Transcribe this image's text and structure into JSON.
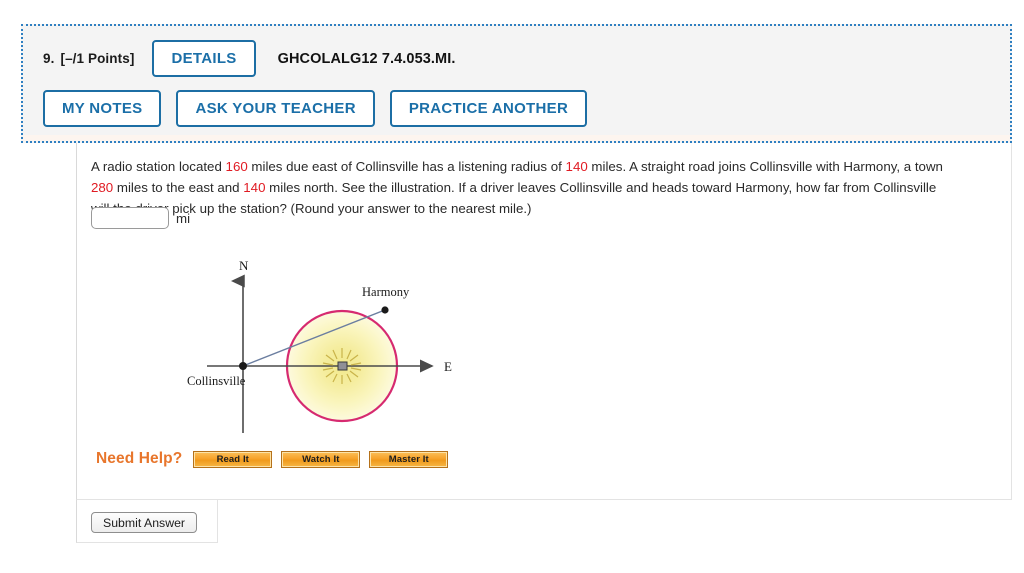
{
  "header": {
    "question_number": "9.",
    "points": "[–/1 Points]",
    "details_label": "DETAILS",
    "question_code": "GHCOLALG12 7.4.053.MI.",
    "my_notes_label": "MY NOTES",
    "ask_teacher_label": "ASK YOUR TEACHER",
    "practice_another_label": "PRACTICE ANOTHER"
  },
  "question": {
    "text_part_1": "A radio station located ",
    "value_1": "160",
    "text_part_2": " miles due east of Collinsville has a listening radius of ",
    "value_2": "140",
    "text_part_3": " miles. A straight road joins Collinsville with Harmony, a town ",
    "value_3": "280",
    "text_part_4": " miles to the east and ",
    "value_4": "140",
    "text_part_5": " miles north. See the illustration. If a driver leaves Collinsville and heads toward Harmony, how far from Collinsville will the driver pick up the station? (Round your answer to the nearest mile.)",
    "answer_value": "",
    "answer_placeholder": "",
    "unit": "mi"
  },
  "illustration": {
    "north_label": "N",
    "east_label": "E",
    "origin_label": "Collinsville",
    "town_label": "Harmony",
    "circle_color": "#d62a70",
    "fill_color": "#f7ef9c",
    "road_color": "#5a6e93",
    "axis_color": "#4a4a4a"
  },
  "need_help": {
    "label": "Need Help?",
    "buttons": [
      {
        "label": "Read It"
      },
      {
        "label": "Watch It"
      },
      {
        "label": "Master It"
      }
    ]
  },
  "submit": {
    "label": "Submit Answer"
  },
  "colors": {
    "accent_blue": "#1c6ea4",
    "dotted_border": "#2e7fc1",
    "red_value": "#e01b23",
    "orange": "#e8762c"
  }
}
